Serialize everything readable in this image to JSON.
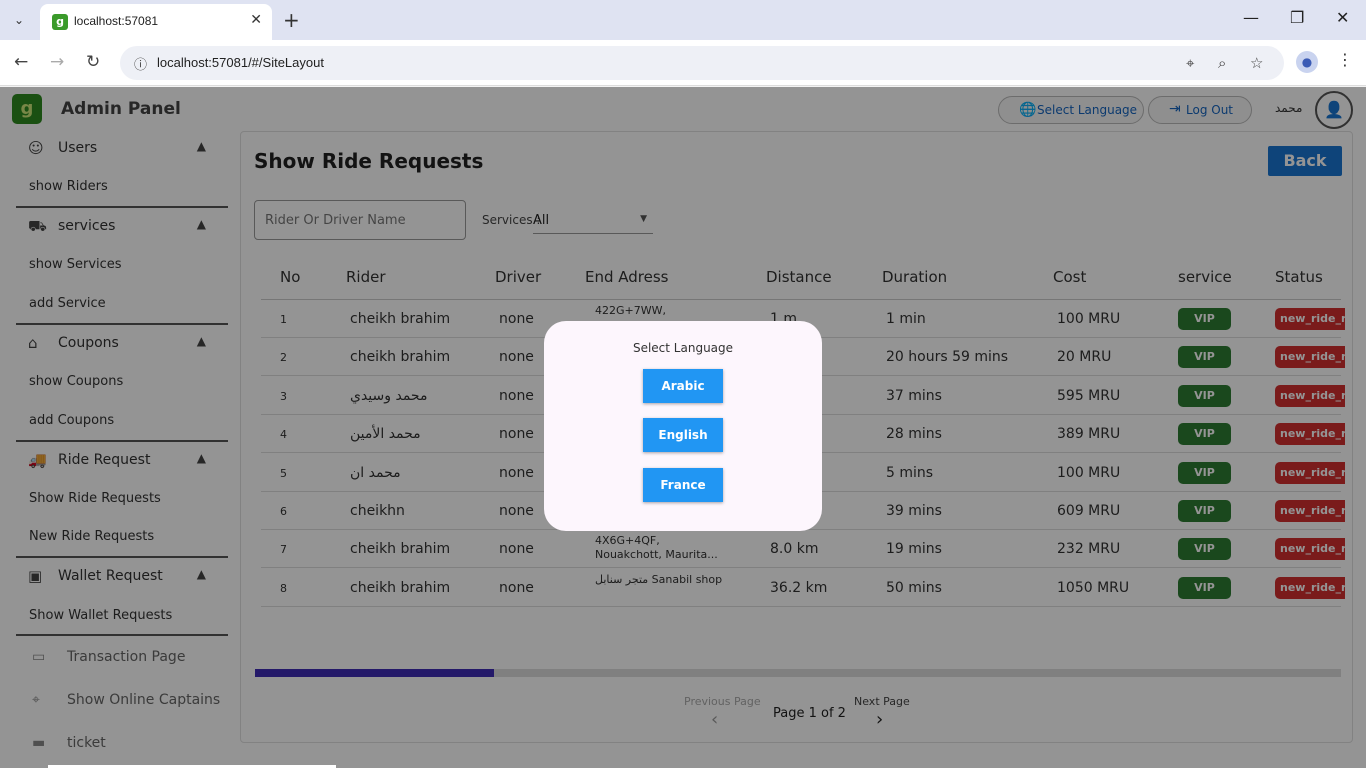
{
  "browser": {
    "tab_title": "localhost:57081",
    "url": "localhost:57081/#/SiteLayout"
  },
  "header": {
    "app_title": "Admin Panel",
    "select_language": "Select Language",
    "log_out": "Log Out",
    "user_name": "محمد"
  },
  "sidebar": {
    "sections": [
      {
        "label": "Users",
        "items": [
          "show Riders"
        ]
      },
      {
        "label": "services",
        "items": [
          "show Services",
          "add Service"
        ]
      },
      {
        "label": "Coupons",
        "items": [
          "show Coupons",
          "add Coupons"
        ]
      },
      {
        "label": "Ride Request",
        "items": [
          "Show Ride Requests",
          "New Ride Requests"
        ]
      },
      {
        "label": "Wallet Request",
        "items": [
          "Show Wallet Requests"
        ]
      }
    ],
    "plain": [
      "Transaction Page",
      "Show Online Captains",
      "ticket"
    ]
  },
  "main": {
    "title": "Show Ride Requests",
    "back": "Back",
    "search_placeholder": "Rider Or Driver Name",
    "services_label": "Services :",
    "services_value": "All",
    "columns": [
      "No",
      "Rider",
      "Driver",
      "End Adress",
      "Distance",
      "Duration",
      "Cost",
      "service",
      "Status"
    ],
    "rows": [
      {
        "no": "1",
        "rider": "cheikh brahim",
        "driver": "none",
        "addr": "422G+7WW,",
        "dist": "1 m",
        "dur": "1 min",
        "cost": "100 MRU",
        "svc": "VIP",
        "status": "new_ride_requested"
      },
      {
        "no": "2",
        "rider": "cheikh brahim",
        "driver": "none",
        "addr": "",
        "dist": "",
        "dur": "20 hours 59 mins",
        "cost": "20 MRU",
        "svc": "VIP",
        "status": "new_ride_requested"
      },
      {
        "no": "3",
        "rider": "محمد وسيدي",
        "driver": "none",
        "addr": "",
        "dist": "",
        "dur": "37 mins",
        "cost": "595 MRU",
        "svc": "VIP",
        "status": "new_ride_requested"
      },
      {
        "no": "4",
        "rider": "محمد الأمين",
        "driver": "none",
        "addr": "",
        "dist": "",
        "dur": "28 mins",
        "cost": "389 MRU",
        "svc": "VIP",
        "status": "new_ride_requested"
      },
      {
        "no": "5",
        "rider": "محمد ان",
        "driver": "none",
        "addr": "",
        "dist": "",
        "dur": "5 mins",
        "cost": "100 MRU",
        "svc": "VIP",
        "status": "new_ride_requested"
      },
      {
        "no": "6",
        "rider": "cheikhn",
        "driver": "none",
        "addr": "",
        "dist": "",
        "dur": "39 mins",
        "cost": "609 MRU",
        "svc": "VIP",
        "status": "new_ride_requested"
      },
      {
        "no": "7",
        "rider": "cheikh brahim",
        "driver": "none",
        "addr": "4X6G+4QF, Nouakchott, Maurita...",
        "dist": "8.0 km",
        "dur": "19 mins",
        "cost": "232 MRU",
        "svc": "VIP",
        "status": "new_ride_requested"
      },
      {
        "no": "8",
        "rider": "cheikh brahim",
        "driver": "none",
        "addr": "متجر سنابل Sanabil shop",
        "dist": "36.2 km",
        "dur": "50 mins",
        "cost": "1050 MRU",
        "svc": "VIP",
        "status": "new_ride_requested"
      }
    ],
    "scroll_fraction": 0.22,
    "pager": {
      "prev": "Previous Page",
      "text": "Page 1 of 2",
      "next": "Next Page"
    }
  },
  "dialog": {
    "title": "Select Language",
    "options": [
      "Arabic",
      "English",
      "France"
    ]
  }
}
